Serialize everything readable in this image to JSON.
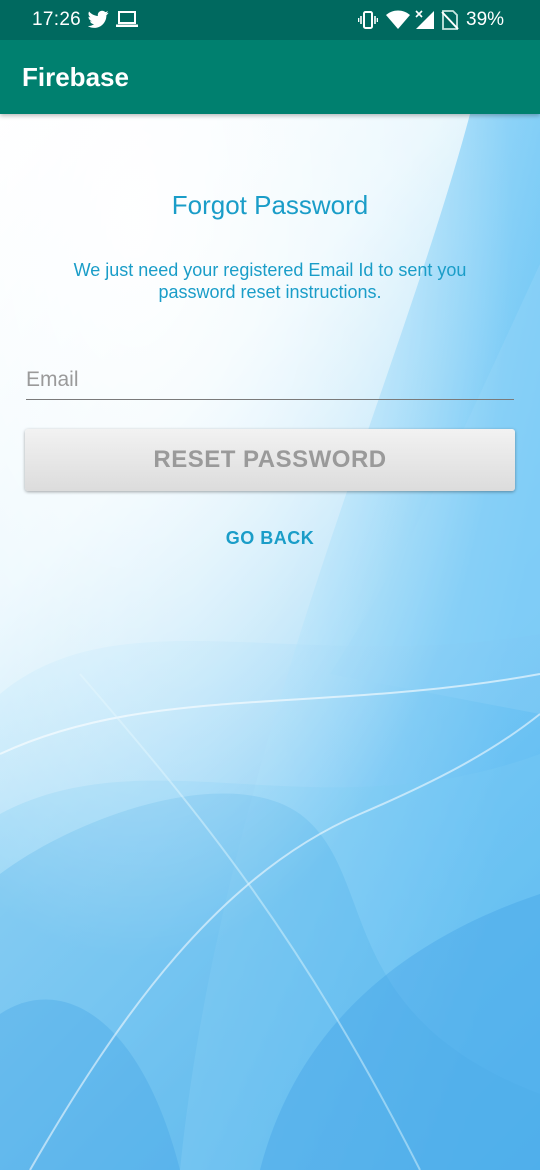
{
  "status_bar": {
    "time": "17:26",
    "battery": "39%",
    "icons": [
      "twitter-icon",
      "laptop-icon",
      "vibrate-icon",
      "wifi-icon",
      "signal-icon",
      "no-sim-icon"
    ]
  },
  "app_bar": {
    "title": "Firebase"
  },
  "form": {
    "heading": "Forgot Password",
    "instructions": "We just need your registered Email Id to sent you password reset instructions.",
    "email_placeholder": "Email",
    "email_value": "",
    "reset_label": "RESET PASSWORD",
    "go_back_label": "GO BACK"
  },
  "colors": {
    "status_bar": "#00695f",
    "app_bar": "#00806f",
    "accent_text": "#1a9dc8",
    "button_text": "#9a9a9a"
  }
}
